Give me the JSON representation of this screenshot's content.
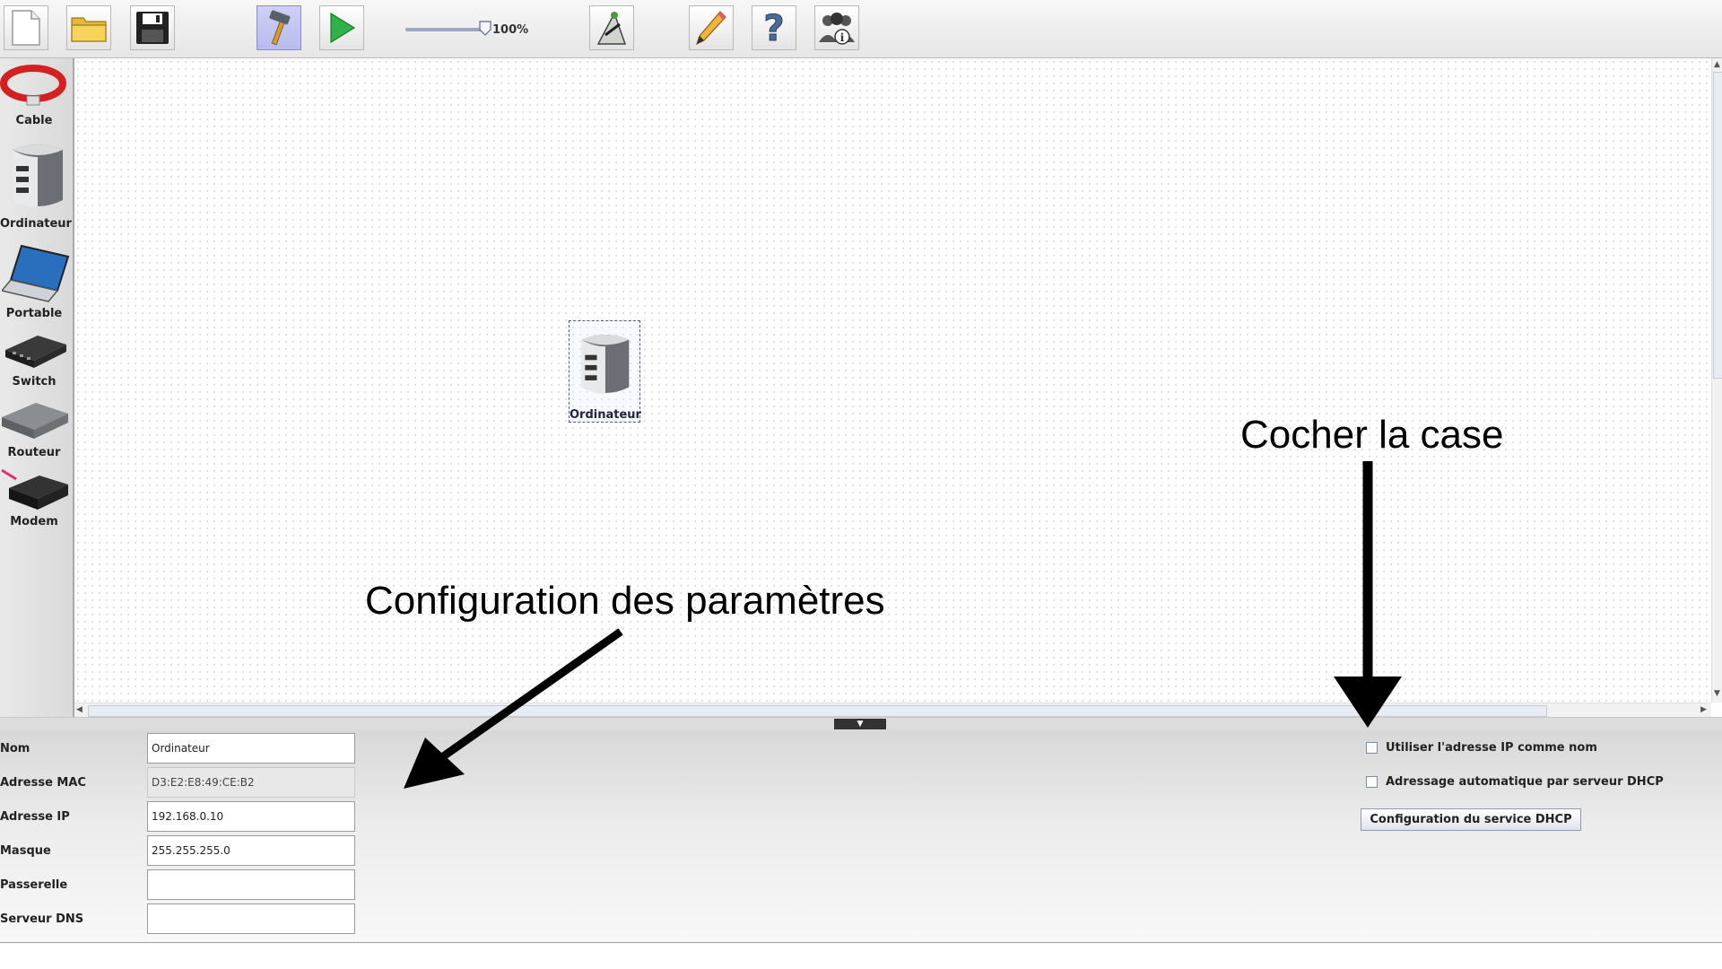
{
  "toolbar": {
    "zoom_value": "100%",
    "icons": [
      "new-file-icon",
      "open-folder-icon",
      "save-icon",
      "hammer-icon",
      "play-icon",
      "network-tool-icon",
      "pencil-icon",
      "help-icon",
      "about-icon"
    ]
  },
  "palette": {
    "items": [
      {
        "label": "Cable"
      },
      {
        "label": "Ordinateur"
      },
      {
        "label": "Portable"
      },
      {
        "label": "Switch"
      },
      {
        "label": "Routeur"
      },
      {
        "label": "Modem"
      }
    ]
  },
  "canvas": {
    "node_label": "Ordinateur"
  },
  "annotations": {
    "config_text": "Configuration des paramètres",
    "checkbox_text": "Cocher la case"
  },
  "properties": {
    "fields": [
      {
        "label": "Nom",
        "value": "Ordinateur"
      },
      {
        "label": "Adresse MAC",
        "value": "D3:E2:E8:49:CE:B2"
      },
      {
        "label": "Adresse IP",
        "value": "192.168.0.10"
      },
      {
        "label": "Masque",
        "value": "255.255.255.0"
      },
      {
        "label": "Passerelle",
        "value": ""
      },
      {
        "label": "Serveur DNS",
        "value": ""
      }
    ],
    "checkboxes": [
      {
        "label": "Utiliser l'adresse IP comme nom",
        "checked": false
      },
      {
        "label": "Adressage automatique par serveur DHCP",
        "checked": false
      }
    ],
    "dhcp_button": "Configuration du service DHCP"
  },
  "colors": {
    "accent_pressed": "#cfd0f5",
    "play_green": "#2fb24a",
    "annotation_black": "#000000"
  }
}
